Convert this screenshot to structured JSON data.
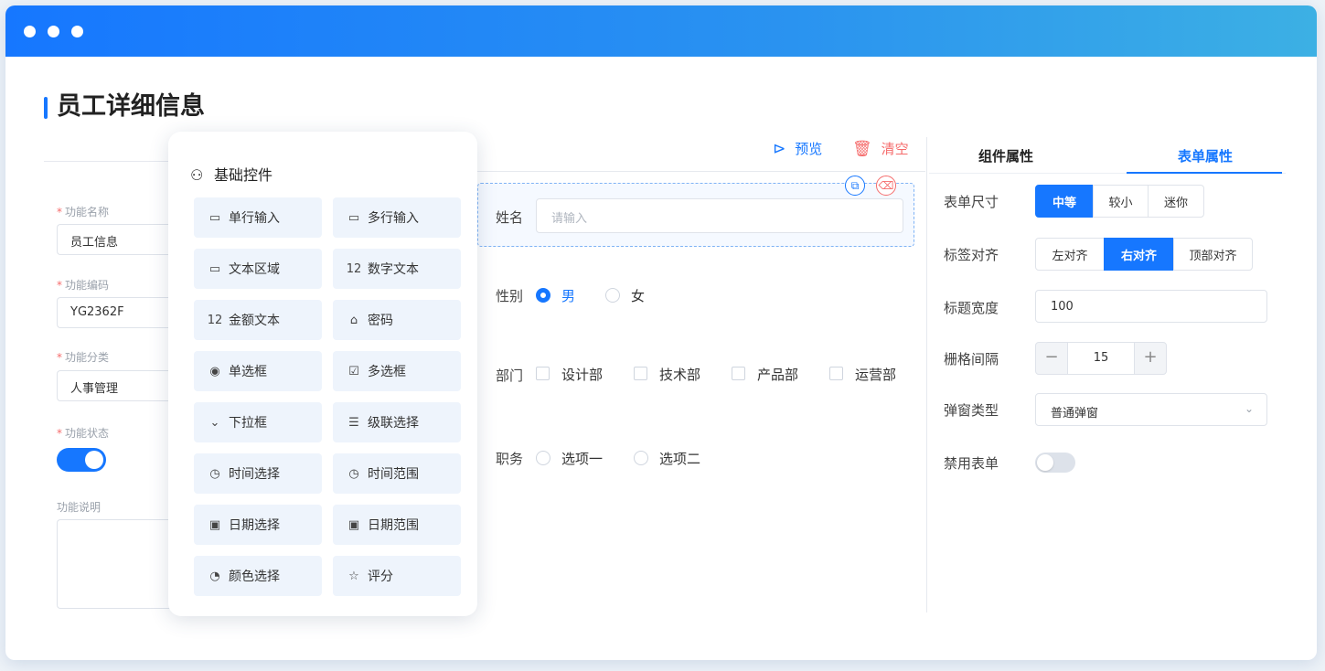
{
  "page_title": "员工详细信息",
  "left_form": {
    "fields": [
      {
        "label": "功能名称",
        "value": "员工信息"
      },
      {
        "label": "功能编码",
        "value": "YG2362F"
      },
      {
        "label": "功能分类",
        "value": "人事管理"
      }
    ],
    "status_label": "功能状态",
    "status_on": true,
    "desc_label": "功能说明"
  },
  "palette": {
    "title": "基础控件",
    "items": [
      {
        "label": "单行输入",
        "icon": "single-line-input-icon",
        "glyph": "▭"
      },
      {
        "label": "多行输入",
        "icon": "multi-line-input-icon",
        "glyph": "▭"
      },
      {
        "label": "文本区域",
        "icon": "text-area-icon",
        "glyph": "▭"
      },
      {
        "label": "数字文本",
        "icon": "number-text-icon",
        "glyph": "12"
      },
      {
        "label": "金额文本",
        "icon": "amount-text-icon",
        "glyph": "12"
      },
      {
        "label": "密码",
        "icon": "lock-icon",
        "glyph": "⌂"
      },
      {
        "label": "单选框",
        "icon": "radio-icon",
        "glyph": "◉"
      },
      {
        "label": "多选框",
        "icon": "checkbox-icon",
        "glyph": "☑"
      },
      {
        "label": "下拉框",
        "icon": "dropdown-icon",
        "glyph": "⌄"
      },
      {
        "label": "级联选择",
        "icon": "cascade-icon",
        "glyph": "☰"
      },
      {
        "label": "时间选择",
        "icon": "clock-icon",
        "glyph": "◷"
      },
      {
        "label": "时间范围",
        "icon": "time-range-icon",
        "glyph": "◷"
      },
      {
        "label": "日期选择",
        "icon": "calendar-icon",
        "glyph": "▣"
      },
      {
        "label": "日期范围",
        "icon": "date-range-icon",
        "glyph": "▣"
      },
      {
        "label": "颜色选择",
        "icon": "color-picker-icon",
        "glyph": "◔"
      },
      {
        "label": "评分",
        "icon": "star-icon",
        "glyph": "☆"
      }
    ]
  },
  "toolbar": {
    "preview": "预览",
    "clear": "清空"
  },
  "canvas": {
    "name_label": "姓名",
    "name_placeholder": "请输入",
    "gender_label": "性别",
    "gender_options": [
      "男",
      "女"
    ],
    "gender_selected": "男",
    "dept_label": "部门",
    "dept_options": [
      "设计部",
      "技术部",
      "产品部",
      "运营部"
    ],
    "post_label": "职务",
    "post_options": [
      "选项一",
      "选项二"
    ]
  },
  "right_panel": {
    "tabs": [
      "组件属性",
      "表单属性"
    ],
    "active_tab": "表单属性",
    "form_size_label": "表单尺寸",
    "form_size_options": [
      "中等",
      "较小",
      "迷你"
    ],
    "form_size_selected": "中等",
    "label_align_label": "标签对齐",
    "label_align_options": [
      "左对齐",
      "右对齐",
      "顶部对齐"
    ],
    "label_align_selected": "右对齐",
    "title_width_label": "标题宽度",
    "title_width_value": "100",
    "grid_gap_label": "栅格间隔",
    "grid_gap_value": "15",
    "dialog_type_label": "弹窗类型",
    "dialog_type_value": "普通弹窗",
    "disable_form_label": "禁用表单",
    "disable_form_on": false
  },
  "colors": {
    "accent": "#1677ff",
    "danger": "#f56c6c"
  }
}
